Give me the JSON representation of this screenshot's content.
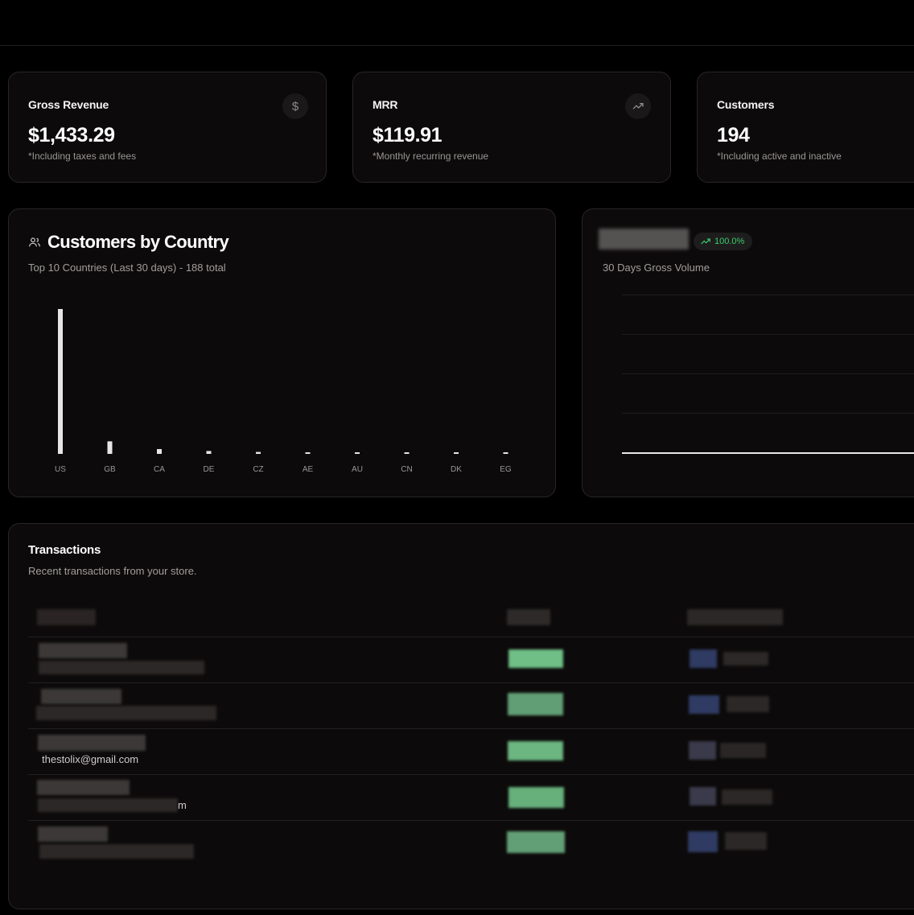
{
  "stats": [
    {
      "title": "Gross Revenue",
      "value": "$1,433.29",
      "note": "*Including taxes and fees",
      "icon": "dollar-icon"
    },
    {
      "title": "MRR",
      "value": "$119.91",
      "note": "*Monthly recurring revenue",
      "icon": "trending-up-icon"
    },
    {
      "title": "Customers",
      "value": "194",
      "note": "*Including active and inactive",
      "icon": ""
    }
  ],
  "country": {
    "title": "Customers by Country",
    "subtitle": "Top 10 Countries (Last 30 days) - 188 total",
    "icon": "users-icon"
  },
  "chart_data": {
    "type": "bar",
    "categories": [
      "US",
      "GB",
      "CA",
      "DE",
      "CZ",
      "AE",
      "AU",
      "CN",
      "DK",
      "EG"
    ],
    "values": [
      150,
      13,
      5,
      3,
      2,
      1,
      1,
      1,
      1,
      1
    ],
    "ylim": [
      0,
      150
    ],
    "grid": false,
    "legend": "none"
  },
  "volume": {
    "badge": "100.0%",
    "subtitle": "30 Days Gross Volume",
    "badge_color": "#3dcc6d"
  },
  "transactions": {
    "title": "Transactions",
    "subtitle": "Recent transactions from your store.",
    "visible_emails": [
      "thestolix@gmail.com",
      "m"
    ]
  },
  "colors": {
    "background": "#000000",
    "card": "#0c0a0a",
    "bar": "#e6e6e6",
    "status_green": "#6fbf86"
  }
}
